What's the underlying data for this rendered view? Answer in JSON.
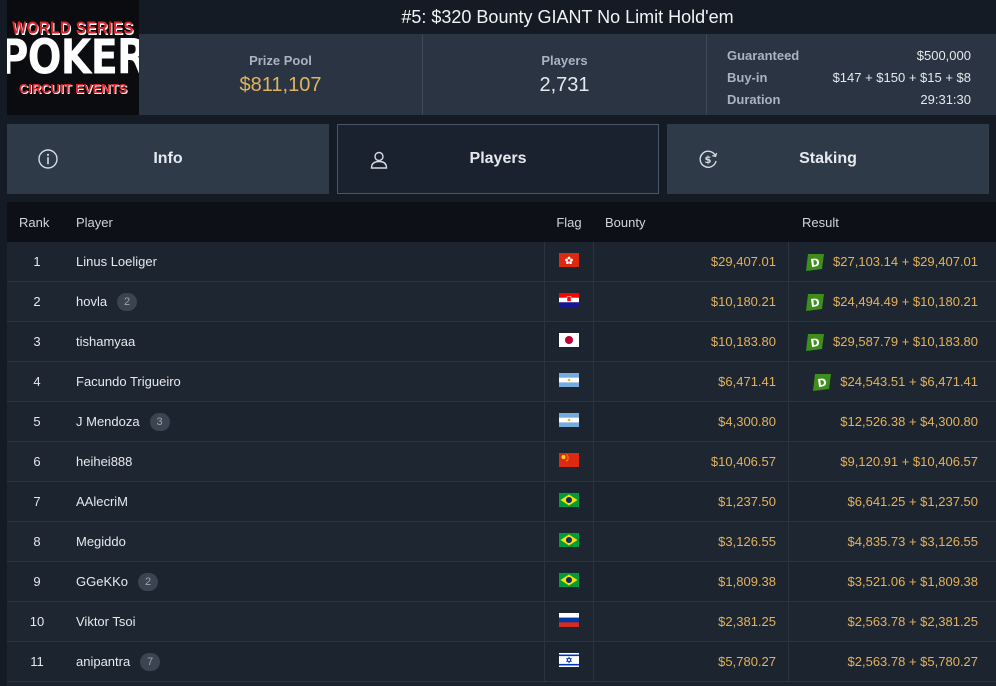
{
  "logo": {
    "line1": "WORLD SERIES",
    "line2": "POKER",
    "line3": "CIRCUIT EVENTS"
  },
  "title": "#5: $320 Bounty GIANT No Limit Hold'em",
  "stats": {
    "prize_pool_label": "Prize Pool",
    "prize_pool": "$811,107",
    "players_label": "Players",
    "players": "2,731",
    "guaranteed_label": "Guaranteed",
    "guaranteed": "$500,000",
    "buyin_label": "Buy-in",
    "buyin": "$147 + $150 + $15 + $8",
    "duration_label": "Duration",
    "duration": "29:31:30"
  },
  "tabs": [
    {
      "label": "Info",
      "icon": "info-icon"
    },
    {
      "label": "Players",
      "icon": "user-icon"
    },
    {
      "label": "Staking",
      "icon": "dollar-coin-icon"
    }
  ],
  "table": {
    "headers": {
      "rank": "Rank",
      "player": "Player",
      "flag": "Flag",
      "bounty": "Bounty",
      "result": "Result"
    },
    "rows": [
      {
        "rank": "1",
        "player": "Linus Loeliger",
        "badge": "",
        "flag": "hong-kong",
        "bounty": "$29,407.01",
        "result": "$27,103.14 + $29,407.01",
        "deal": true
      },
      {
        "rank": "2",
        "player": "hovla",
        "badge": "2",
        "flag": "croatia",
        "bounty": "$10,180.21",
        "result": "$24,494.49 + $10,180.21",
        "deal": true
      },
      {
        "rank": "3",
        "player": "tishamyaa",
        "badge": "",
        "flag": "japan",
        "bounty": "$10,183.80",
        "result": "$29,587.79 + $10,183.80",
        "deal": true
      },
      {
        "rank": "4",
        "player": "Facundo Trigueiro",
        "badge": "",
        "flag": "argentina",
        "bounty": "$6,471.41",
        "result": "$24,543.51 + $6,471.41",
        "deal": true
      },
      {
        "rank": "5",
        "player": "J Mendoza",
        "badge": "3",
        "flag": "argentina",
        "bounty": "$4,300.80",
        "result": "$12,526.38 + $4,300.80",
        "deal": false
      },
      {
        "rank": "6",
        "player": "heihei888",
        "badge": "",
        "flag": "china",
        "bounty": "$10,406.57",
        "result": "$9,120.91 + $10,406.57",
        "deal": false
      },
      {
        "rank": "7",
        "player": "AAlecriM",
        "badge": "",
        "flag": "brazil",
        "bounty": "$1,237.50",
        "result": "$6,641.25 + $1,237.50",
        "deal": false
      },
      {
        "rank": "8",
        "player": "Megiddo",
        "badge": "",
        "flag": "brazil",
        "bounty": "$3,126.55",
        "result": "$4,835.73 + $3,126.55",
        "deal": false
      },
      {
        "rank": "9",
        "player": "GGeKKo",
        "badge": "2",
        "flag": "brazil",
        "bounty": "$1,809.38",
        "result": "$3,521.06 + $1,809.38",
        "deal": false
      },
      {
        "rank": "10",
        "player": "Viktor Tsoi",
        "badge": "",
        "flag": "russia",
        "bounty": "$2,381.25",
        "result": "$2,563.78 + $2,381.25",
        "deal": false
      },
      {
        "rank": "11",
        "player": "anipantra",
        "badge": "7",
        "flag": "israel",
        "bounty": "$5,780.27",
        "result": "$2,563.78 + $5,780.27",
        "deal": false
      }
    ]
  },
  "colors": {
    "gold": "#e3b25d",
    "background": "#141b24",
    "deal_badge": "#3e8e1e"
  }
}
